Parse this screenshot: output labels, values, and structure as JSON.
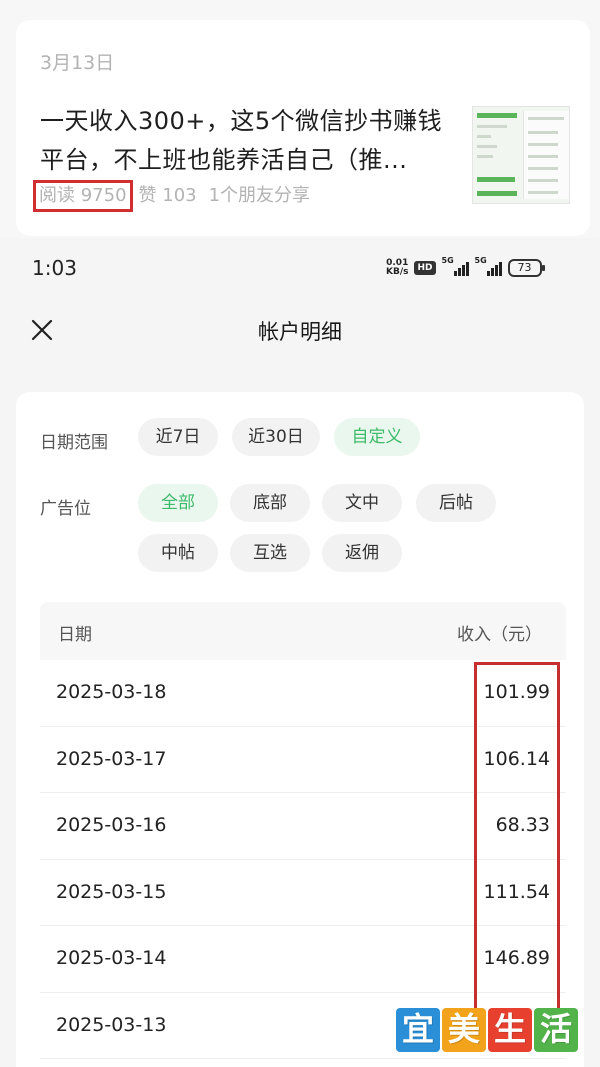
{
  "article": {
    "date": "3月13日",
    "title_line1": "一天收入300+，这5个微信抄书赚钱",
    "title_line2": "平台，不上班也能养活自己（推...",
    "reads": "阅读 9750",
    "likes": "赞 103",
    "shares": "1个朋友分享",
    "highlight_color": "#d12f2f"
  },
  "status_bar": {
    "time": "1:03",
    "net_speed_value": "0.01",
    "net_speed_unit": "KB/s",
    "hd_badge": "HD",
    "signal1_label": "5G",
    "signal2_label": "5G",
    "battery": "73"
  },
  "header": {
    "title": "帐户明细",
    "close_icon": "close-icon"
  },
  "filters": {
    "date_range_label": "日期范围",
    "date_options": [
      {
        "label": "近7日",
        "active": false
      },
      {
        "label": "近30日",
        "active": false
      },
      {
        "label": "自定义",
        "active": true
      }
    ],
    "ad_position_label": "广告位",
    "ad_options": [
      {
        "label": "全部",
        "active": true
      },
      {
        "label": "底部",
        "active": false
      },
      {
        "label": "文中",
        "active": false
      },
      {
        "label": "后帖",
        "active": false
      },
      {
        "label": "中帖",
        "active": false
      },
      {
        "label": "互选",
        "active": false
      },
      {
        "label": "返佣",
        "active": false
      }
    ],
    "active_color": "#3dba6a"
  },
  "table": {
    "headers": {
      "date": "日期",
      "income": "收入（元）"
    },
    "rows": [
      {
        "date": "2025-03-18",
        "income": "101.99"
      },
      {
        "date": "2025-03-17",
        "income": "106.14"
      },
      {
        "date": "2025-03-16",
        "income": "68.33"
      },
      {
        "date": "2025-03-15",
        "income": "111.54"
      },
      {
        "date": "2025-03-14",
        "income": "146.89"
      },
      {
        "date": "2025-03-13",
        "income": ""
      }
    ]
  },
  "watermark": {
    "chars": [
      "宜",
      "美",
      "生",
      "活"
    ],
    "colors": [
      "#2a8fd6",
      "#f2a21b",
      "#e8402f",
      "#52b34a"
    ]
  }
}
